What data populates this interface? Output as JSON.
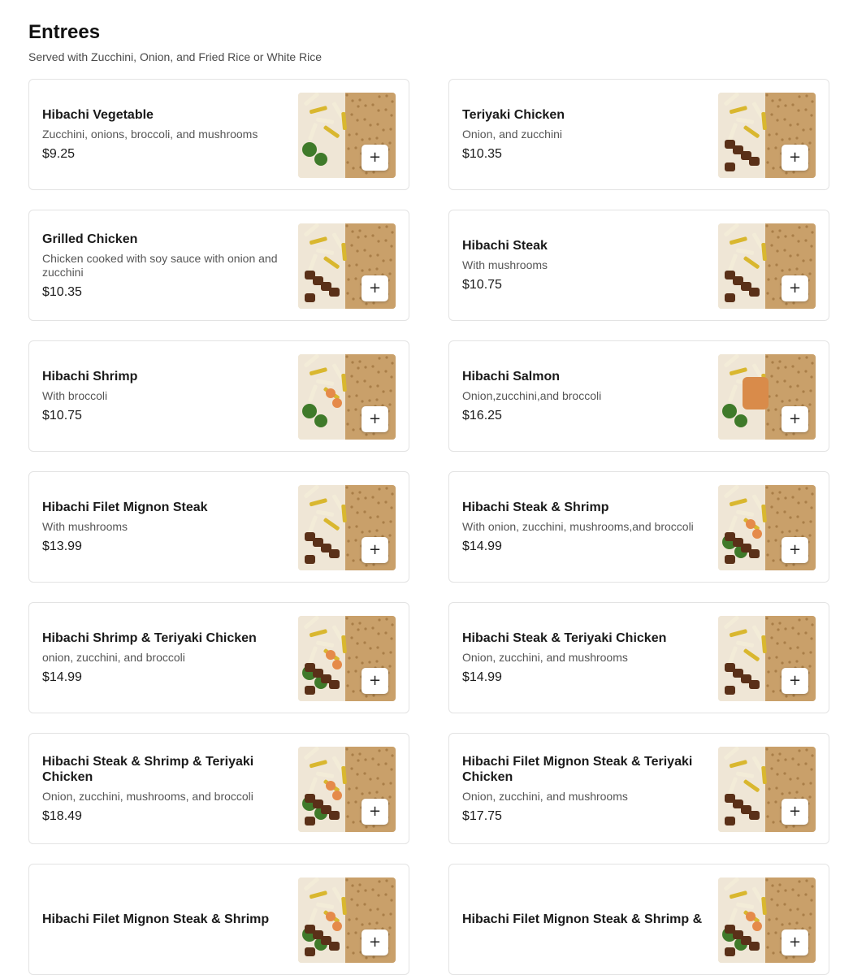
{
  "section": {
    "title": "Entrees",
    "subtitle": "Served with Zucchini, Onion, and Fried Rice or White Rice"
  },
  "add_symbol": "+",
  "items": [
    {
      "name": "Hibachi Vegetable",
      "description": "Zucchini, onions, broccoli, and mushrooms",
      "price": "$9.25",
      "image": "vegetable-plate"
    },
    {
      "name": "Teriyaki Chicken",
      "description": "Onion, and zucchini",
      "price": "$10.35",
      "image": "teriyaki-chicken-plate"
    },
    {
      "name": "Grilled Chicken",
      "description": "Chicken cooked with soy sauce with onion and zucchini",
      "price": "$10.35",
      "image": "grilled-chicken-plate"
    },
    {
      "name": "Hibachi Steak",
      "description": "With mushrooms",
      "price": "$10.75",
      "image": "steak-plate"
    },
    {
      "name": "Hibachi Shrimp",
      "description": "With broccoli",
      "price": "$10.75",
      "image": "shrimp-plate"
    },
    {
      "name": "Hibachi Salmon",
      "description": "Onion,zucchini,and broccoli",
      "price": "$16.25",
      "image": "salmon-plate"
    },
    {
      "name": "Hibachi Filet Mignon Steak",
      "description": "With mushrooms",
      "price": "$13.99",
      "image": "filet-mignon-plate"
    },
    {
      "name": "Hibachi Steak & Shrimp",
      "description": "With onion, zucchini, mushrooms,and broccoli",
      "price": "$14.99",
      "image": "steak-shrimp-plate"
    },
    {
      "name": "Hibachi Shrimp & Teriyaki Chicken",
      "description": "onion, zucchini, and broccoli",
      "price": "$14.99",
      "image": "shrimp-chicken-plate"
    },
    {
      "name": "Hibachi Steak & Teriyaki Chicken",
      "description": "Onion, zucchini, and mushrooms",
      "price": "$14.99",
      "image": "steak-chicken-plate"
    },
    {
      "name": "Hibachi Steak & Shrimp & Teriyaki Chicken",
      "description": "Onion, zucchini, mushrooms, and broccoli",
      "price": "$18.49",
      "image": "steak-shrimp-chicken-plate"
    },
    {
      "name": "Hibachi Filet Mignon Steak & Teriyaki Chicken",
      "description": "Onion, zucchini, and mushrooms",
      "price": "$17.75",
      "image": "filet-chicken-plate"
    },
    {
      "name": "Hibachi Filet Mignon Steak & Shrimp",
      "description": "",
      "price": "",
      "image": "filet-shrimp-plate"
    },
    {
      "name": "Hibachi Filet Mignon Steak & Shrimp &",
      "description": "",
      "price": "",
      "image": "filet-shrimp-more-plate"
    }
  ],
  "colors": {
    "rice": "#c9a06a",
    "plate": "#efe6d6",
    "broccoli": "#3f7a2a",
    "zucchini": "#d9b72f",
    "onion": "#f3ecd8",
    "meat": "#5a3018",
    "shrimp": "#e58a4a"
  }
}
